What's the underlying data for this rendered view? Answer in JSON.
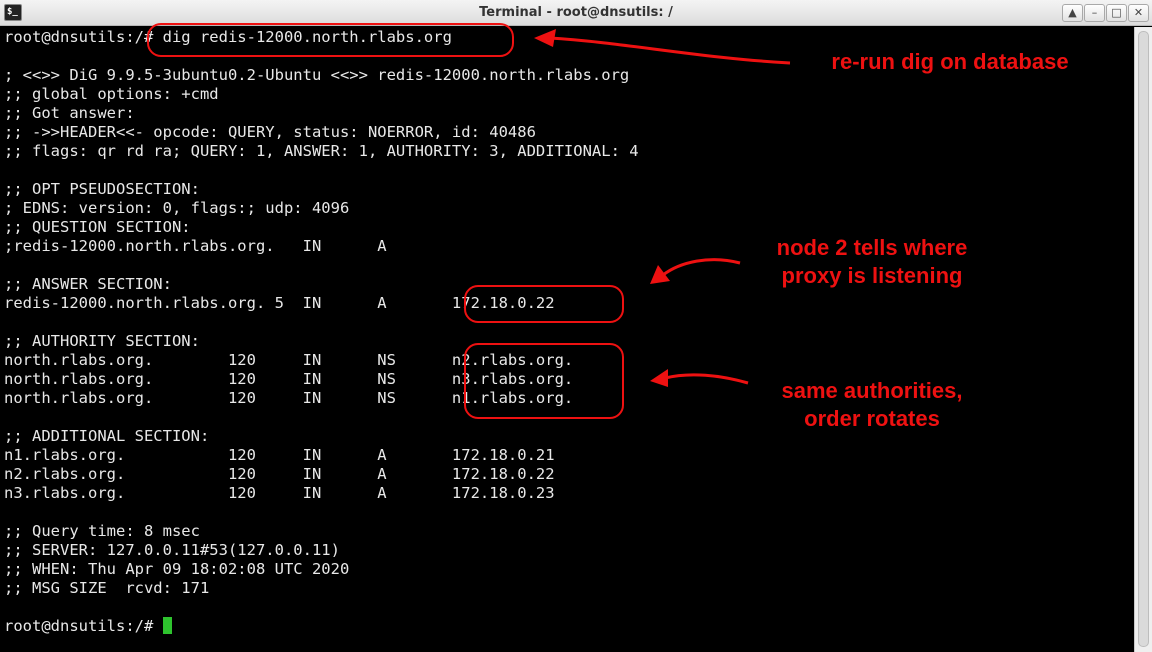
{
  "window": {
    "title": "Terminal - root@dnsutils: /",
    "app_icon": "terminal-icon",
    "buttons": {
      "up": "▲",
      "minimize": "–",
      "maximize": "□",
      "close": "✕"
    }
  },
  "terminal": {
    "lines": [
      "root@dnsutils:/# dig redis-12000.north.rlabs.org",
      "",
      "; <<>> DiG 9.9.5-3ubuntu0.2-Ubuntu <<>> redis-12000.north.rlabs.org",
      ";; global options: +cmd",
      ";; Got answer:",
      ";; ->>HEADER<<- opcode: QUERY, status: NOERROR, id: 40486",
      ";; flags: qr rd ra; QUERY: 1, ANSWER: 1, AUTHORITY: 3, ADDITIONAL: 4",
      "",
      ";; OPT PSEUDOSECTION:",
      "; EDNS: version: 0, flags:; udp: 4096",
      ";; QUESTION SECTION:",
      ";redis-12000.north.rlabs.org.   IN      A",
      "",
      ";; ANSWER SECTION:",
      "redis-12000.north.rlabs.org. 5  IN      A       172.18.0.22",
      "",
      ";; AUTHORITY SECTION:",
      "north.rlabs.org.        120     IN      NS      n2.rlabs.org.",
      "north.rlabs.org.        120     IN      NS      n3.rlabs.org.",
      "north.rlabs.org.        120     IN      NS      n1.rlabs.org.",
      "",
      ";; ADDITIONAL SECTION:",
      "n1.rlabs.org.           120     IN      A       172.18.0.21",
      "n2.rlabs.org.           120     IN      A       172.18.0.22",
      "n3.rlabs.org.           120     IN      A       172.18.0.23",
      "",
      ";; Query time: 8 msec",
      ";; SERVER: 127.0.0.11#53(127.0.0.11)",
      ";; WHEN: Thu Apr 09 18:02:08 UTC 2020",
      ";; MSG SIZE  rcvd: 171",
      ""
    ],
    "prompt": "root@dnsutils:/# ",
    "cursor_color": "#2ec32e"
  },
  "annotations": {
    "color": "#ee1111",
    "rerun": "re-run dig on database",
    "node2": "node 2 tells where\nproxy is listening",
    "authorities": "same authorities,\norder rotates"
  }
}
